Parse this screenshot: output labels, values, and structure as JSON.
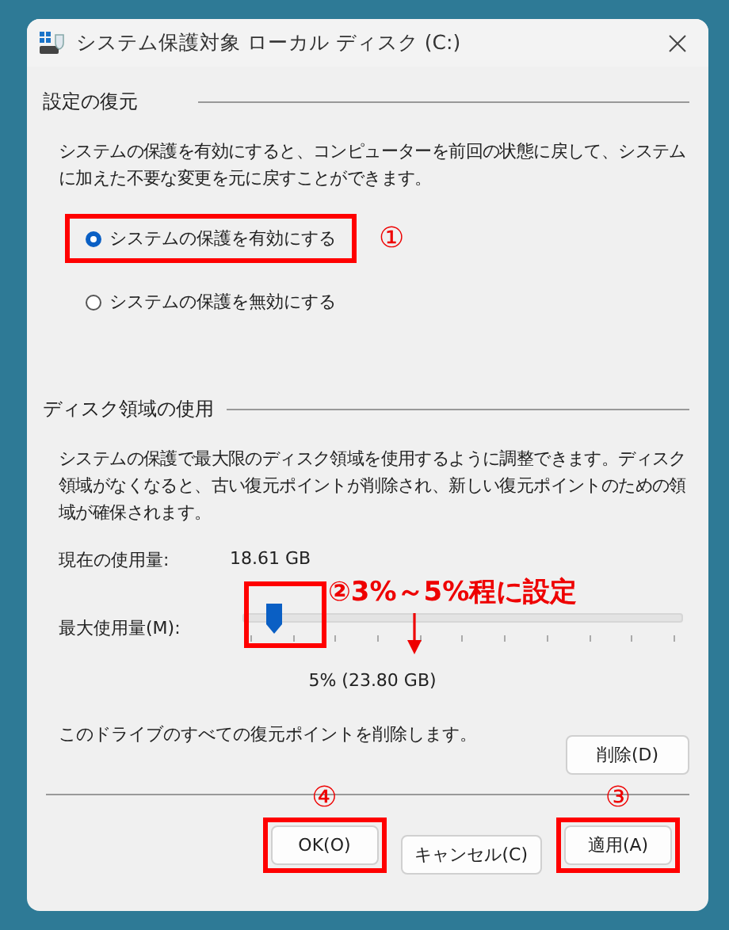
{
  "window": {
    "title": "システム保護対象 ローカル ディスク (C:)"
  },
  "restore_settings": {
    "heading": "設定の復元",
    "description": "システムの保護を有効にすると、コンピューターを前回の状態に戻して、システムに加えた不要な変更を元に戻すことができます。",
    "options": [
      {
        "label": "システムの保護を有効にする",
        "selected": true,
        "highlighted": true,
        "marker": "①"
      },
      {
        "label": "システムの保護を無効にする",
        "selected": false,
        "highlighted": false
      }
    ]
  },
  "disk_usage": {
    "heading": "ディスク領域の使用",
    "description": "システムの保護で最大限のディスク領域を使用するように調整できます。ディスク領域がなくなると、古い復元ポイントが削除され、新しい復元ポイントのための領域が確保されます。",
    "current_label": "現在の使用量:",
    "current_value": "18.61 GB",
    "max_label": "最大使用量(M):",
    "slider": {
      "level": 0.05,
      "highlighted": true,
      "marker": "②3%～5%程に設定"
    },
    "max_value": "5% (23.80 GB)",
    "delete_text": "このドライブのすべての復元ポイントを削除します。",
    "delete_button": "削除(D)"
  },
  "buttons": [
    {
      "label": "OK(O)",
      "highlighted": true,
      "marker": "④"
    },
    {
      "label": "キャンセル(C)",
      "highlighted": false
    },
    {
      "label": "適用(A)",
      "highlighted": true,
      "marker": "③"
    }
  ]
}
